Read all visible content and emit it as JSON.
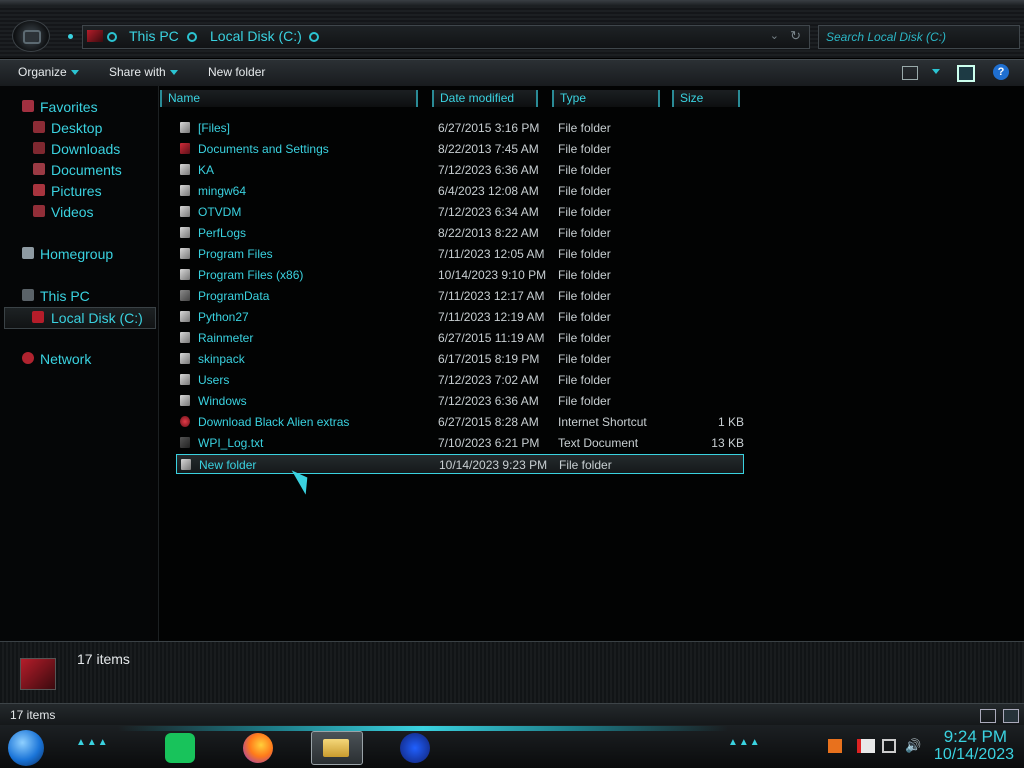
{
  "address": {
    "crumbs": [
      "This PC",
      "Local Disk (C:)"
    ],
    "search_placeholder": "Search Local Disk (C:)"
  },
  "toolbar": {
    "organize": "Organize",
    "share_with": "Share with",
    "new_folder": "New folder"
  },
  "nav": {
    "favorites": "Favorites",
    "desktop": "Desktop",
    "downloads": "Downloads",
    "documents": "Documents",
    "pictures": "Pictures",
    "videos": "Videos",
    "homegroup": "Homegroup",
    "this_pc": "This PC",
    "local_disk": "Local Disk (C:)",
    "network": "Network"
  },
  "columns": {
    "name": "Name",
    "date": "Date modified",
    "type": "Type",
    "size": "Size"
  },
  "files": [
    {
      "name": "[Files]",
      "date": "6/27/2015 3:16 PM",
      "type": "File folder",
      "size": ""
    },
    {
      "name": "Documents and Settings",
      "date": "8/22/2013 7:45 AM",
      "type": "File folder",
      "size": ""
    },
    {
      "name": "KA",
      "date": "7/12/2023 6:36 AM",
      "type": "File folder",
      "size": ""
    },
    {
      "name": "mingw64",
      "date": "6/4/2023 12:08 AM",
      "type": "File folder",
      "size": ""
    },
    {
      "name": "OTVDM",
      "date": "7/12/2023 6:34 AM",
      "type": "File folder",
      "size": ""
    },
    {
      "name": "PerfLogs",
      "date": "8/22/2013 8:22 AM",
      "type": "File folder",
      "size": ""
    },
    {
      "name": "Program Files",
      "date": "7/11/2023 12:05 AM",
      "type": "File folder",
      "size": ""
    },
    {
      "name": "Program Files (x86)",
      "date": "10/14/2023 9:10 PM",
      "type": "File folder",
      "size": ""
    },
    {
      "name": "ProgramData",
      "date": "7/11/2023 12:17 AM",
      "type": "File folder",
      "size": ""
    },
    {
      "name": "Python27",
      "date": "7/11/2023 12:19 AM",
      "type": "File folder",
      "size": ""
    },
    {
      "name": "Rainmeter",
      "date": "6/27/2015 11:19 AM",
      "type": "File folder",
      "size": ""
    },
    {
      "name": "skinpack",
      "date": "6/17/2015 8:19 PM",
      "type": "File folder",
      "size": ""
    },
    {
      "name": "Users",
      "date": "7/12/2023 7:02 AM",
      "type": "File folder",
      "size": ""
    },
    {
      "name": "Windows",
      "date": "7/12/2023 6:36 AM",
      "type": "File folder",
      "size": ""
    },
    {
      "name": "Download Black Alien extras",
      "date": "6/27/2015 8:28 AM",
      "type": "Internet Shortcut",
      "size": "1 KB"
    },
    {
      "name": "WPI_Log.txt",
      "date": "7/10/2023 6:21 PM",
      "type": "Text Document",
      "size": "13 KB"
    },
    {
      "name": "New folder",
      "date": "10/14/2023 9:23 PM",
      "type": "File folder",
      "size": ""
    }
  ],
  "details": {
    "count": "17 items"
  },
  "status": {
    "count": "17 items"
  },
  "clock": {
    "time": "9:24 PM",
    "date": "10/14/2023"
  },
  "colors": {
    "accent": "#3ad2e0",
    "background": "#000000"
  }
}
